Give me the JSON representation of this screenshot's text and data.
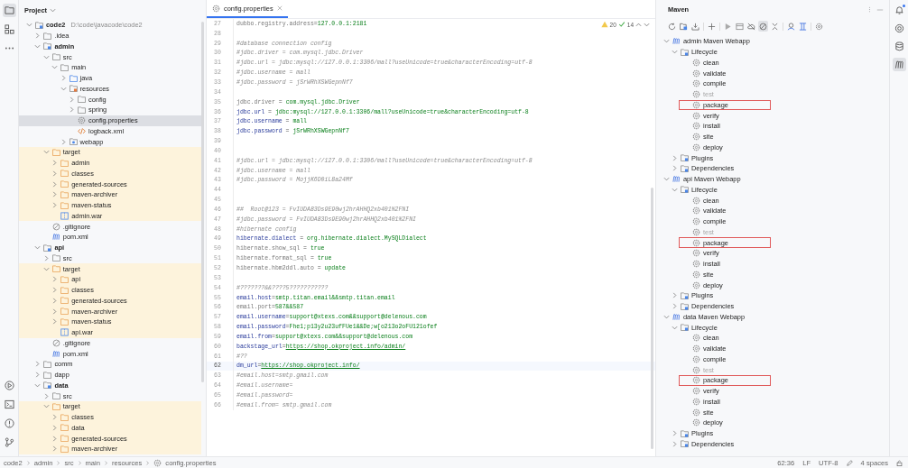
{
  "left_strip": {
    "top": [
      {
        "kind": "project",
        "selected": true
      },
      {
        "kind": "structure",
        "selected": false
      },
      {
        "kind": "more",
        "selected": false
      }
    ],
    "bottom": [
      {
        "kind": "run"
      },
      {
        "kind": "terminal"
      },
      {
        "kind": "problems"
      },
      {
        "kind": "git"
      }
    ]
  },
  "project": {
    "title": "Project",
    "tree": [
      {
        "name": "code2",
        "location": "D:\\code\\javacode\\code2",
        "kind": "module",
        "expanded": true,
        "selected": false,
        "children": [
          {
            "name": ".idea",
            "kind": "folder",
            "expanded": false,
            "selected": false
          },
          {
            "name": "admin",
            "kind": "module",
            "expanded": true,
            "selected": false,
            "children": [
              {
                "name": "src",
                "kind": "folder",
                "expanded": true,
                "selected": false,
                "children": [
                  {
                    "name": "main",
                    "kind": "folder",
                    "expanded": true,
                    "selected": false,
                    "children": [
                      {
                        "name": "java",
                        "kind": "source",
                        "expanded": false,
                        "selected": false
                      },
                      {
                        "name": "resources",
                        "kind": "resources",
                        "expanded": true,
                        "selected": false,
                        "children": [
                          {
                            "name": "config",
                            "kind": "folder",
                            "expanded": false,
                            "selected": false
                          },
                          {
                            "name": "spring",
                            "kind": "folder",
                            "expanded": false,
                            "selected": false
                          },
                          {
                            "name": "config.properties",
                            "kind": "properties",
                            "selected": true
                          },
                          {
                            "name": "logback.xml",
                            "kind": "xml",
                            "selected": false
                          }
                        ]
                      },
                      {
                        "name": "webapp",
                        "kind": "webapp",
                        "expanded": false,
                        "selected": false
                      }
                    ]
                  }
                ]
              },
              {
                "name": "target",
                "kind": "folder",
                "excluded": true,
                "expanded": true,
                "selected": false,
                "children": [
                  {
                    "name": "admin",
                    "kind": "folder",
                    "expanded": false,
                    "selected": false
                  },
                  {
                    "name": "classes",
                    "kind": "folder",
                    "expanded": false,
                    "selected": false
                  },
                  {
                    "name": "generated-sources",
                    "kind": "folder",
                    "expanded": false,
                    "selected": false
                  },
                  {
                    "name": "maven-archiver",
                    "kind": "folder",
                    "expanded": false,
                    "selected": false
                  },
                  {
                    "name": "maven-status",
                    "kind": "folder",
                    "expanded": false,
                    "selected": false
                  },
                  {
                    "name": "admin.war",
                    "kind": "war",
                    "selected": false
                  }
                ]
              },
              {
                "name": ".gitignore",
                "kind": "gitignore",
                "selected": false
              },
              {
                "name": "pom.xml",
                "kind": "pom",
                "selected": false
              }
            ]
          },
          {
            "name": "api",
            "kind": "module",
            "expanded": true,
            "selected": false,
            "children": [
              {
                "name": "src",
                "kind": "folder",
                "expanded": false,
                "selected": false
              },
              {
                "name": "target",
                "kind": "folder",
                "excluded": true,
                "expanded": true,
                "selected": false,
                "children": [
                  {
                    "name": "api",
                    "kind": "folder",
                    "expanded": false,
                    "selected": false
                  },
                  {
                    "name": "classes",
                    "kind": "folder",
                    "expanded": false,
                    "selected": false
                  },
                  {
                    "name": "generated-sources",
                    "kind": "folder",
                    "expanded": false,
                    "selected": false
                  },
                  {
                    "name": "maven-archiver",
                    "kind": "folder",
                    "expanded": false,
                    "selected": false
                  },
                  {
                    "name": "maven-status",
                    "kind": "folder",
                    "expanded": false,
                    "selected": false
                  },
                  {
                    "name": "api.war",
                    "kind": "war",
                    "selected": false
                  }
                ]
              },
              {
                "name": ".gitignore",
                "kind": "gitignore",
                "selected": false
              },
              {
                "name": "pom.xml",
                "kind": "pom",
                "selected": false
              }
            ]
          },
          {
            "name": "comm",
            "kind": "folder",
            "expanded": false,
            "selected": false
          },
          {
            "name": "dapp",
            "kind": "folder",
            "expanded": false,
            "selected": false
          },
          {
            "name": "data",
            "kind": "module",
            "expanded": true,
            "selected": false,
            "children": [
              {
                "name": "src",
                "kind": "folder",
                "expanded": false,
                "selected": false
              },
              {
                "name": "target",
                "kind": "folder",
                "excluded": true,
                "expanded": true,
                "selected": false,
                "children": [
                  {
                    "name": "classes",
                    "kind": "folder",
                    "expanded": false,
                    "selected": false
                  },
                  {
                    "name": "data",
                    "kind": "folder",
                    "expanded": false,
                    "selected": false
                  },
                  {
                    "name": "generated-sources",
                    "kind": "folder",
                    "expanded": false,
                    "selected": false
                  },
                  {
                    "name": "maven-archiver",
                    "kind": "folder",
                    "expanded": false,
                    "selected": false
                  }
                ]
              }
            ]
          }
        ]
      }
    ]
  },
  "editor": {
    "tabs": [
      {
        "label": "config.properties",
        "selected": true
      }
    ],
    "inspections": {
      "warnings": "20",
      "weak_warnings": "14"
    },
    "lines": [
      {
        "number": "27",
        "kind": "property",
        "key": "dubbo.registry.address",
        "sep": "=",
        "value": "127.0.0.1:2181",
        "used": false,
        "current": false
      },
      {
        "number": "28",
        "kind": "blank",
        "current": false
      },
      {
        "number": "29",
        "kind": "comment",
        "text": "#database connection config",
        "current": false
      },
      {
        "number": "30",
        "kind": "comment",
        "text": "#jdbc.driver = com.mysql.jdbc.Driver",
        "current": false
      },
      {
        "number": "31",
        "kind": "comment",
        "text": "#jdbc.url = jdbc:mysql://127.0.0.1:3306/mall?useUnicode=true&characterEncoding=utf-8",
        "current": false
      },
      {
        "number": "32",
        "kind": "comment",
        "text": "#jdbc.username = mall",
        "current": false
      },
      {
        "number": "33",
        "kind": "comment",
        "text": "#jdbc.password = jSrWRhXSWGepnNf7",
        "current": false
      },
      {
        "number": "34",
        "kind": "blank",
        "current": false
      },
      {
        "number": "35",
        "kind": "property",
        "key": "jdbc.driver",
        "sep": " = ",
        "value": "com.mysql.jdbc.Driver",
        "used": false,
        "current": false
      },
      {
        "number": "36",
        "kind": "property",
        "key": "jdbc.url",
        "sep": " = ",
        "value": "jdbc:mysql://127.0.0.1:3306/mall?useUnicode=true&characterEncoding=utf-8",
        "used": true,
        "current": false
      },
      {
        "number": "37",
        "kind": "property",
        "key": "jdbc.username",
        "sep": " = ",
        "value": "mall",
        "used": true,
        "current": false
      },
      {
        "number": "38",
        "kind": "property",
        "key": "jdbc.password",
        "sep": " = ",
        "value": "jSrWRhXSWGepnNf7",
        "used": true,
        "current": false
      },
      {
        "number": "39",
        "kind": "blank",
        "current": false
      },
      {
        "number": "40",
        "kind": "blank",
        "current": false
      },
      {
        "number": "41",
        "kind": "comment",
        "text": "#jdbc.url = jdbc:mysql://127.0.0.1:3306/mall?useUnicode=true&characterEncoding=utf-8",
        "current": false
      },
      {
        "number": "42",
        "kind": "comment",
        "text": "#jdbc.username = mall",
        "current": false
      },
      {
        "number": "43",
        "kind": "comment",
        "text": "#jdbc.password = MojjK6D0iL8a24Mf",
        "current": false
      },
      {
        "number": "44",
        "kind": "blank",
        "current": false
      },
      {
        "number": "45",
        "kind": "blank",
        "current": false
      },
      {
        "number": "46",
        "kind": "comment",
        "text": "##  Root@123 = FvIUDA83Ds9E90wj2hrAHHQ2xb401%2FNI",
        "current": false
      },
      {
        "number": "47",
        "kind": "comment",
        "text": "#jdbc.password = FvIUDA83Ds9E90wj2hrAHHQ2xb401%2FNI",
        "current": false
      },
      {
        "number": "48",
        "kind": "comment",
        "text": "#hibernate config",
        "current": false
      },
      {
        "number": "49",
        "kind": "property",
        "key": "hibernate.dialect",
        "sep": " = ",
        "value": "org.hibernate.dialect.MySQLDialect",
        "used": true,
        "current": false
      },
      {
        "number": "50",
        "kind": "property",
        "key": "hibernate.show_sql",
        "sep": " = ",
        "value": "true",
        "used": false,
        "current": false
      },
      {
        "number": "51",
        "kind": "property",
        "key": "hibernate.format_sql",
        "sep": " = ",
        "value": "true",
        "used": false,
        "current": false
      },
      {
        "number": "52",
        "kind": "property",
        "key": "hibernate.hbm2ddl.auto",
        "sep": " = ",
        "value": "update",
        "used": false,
        "current": false
      },
      {
        "number": "53",
        "kind": "blank",
        "current": false
      },
      {
        "number": "54",
        "kind": "comment",
        "text": "#???????&&????5???????????",
        "current": false
      },
      {
        "number": "55",
        "kind": "property",
        "key": "email.host",
        "sep": "=",
        "value": "smtp.titan.email&&smtp.titan.email",
        "used": true,
        "current": false
      },
      {
        "number": "56",
        "kind": "property",
        "key": "email.port",
        "sep": "=",
        "value": "587&&587",
        "used": false,
        "current": false
      },
      {
        "number": "57",
        "kind": "property",
        "key": "email.username",
        "sep": "=",
        "value": "support@xtexs.com&&support@delenous.com",
        "used": true,
        "current": false
      },
      {
        "number": "58",
        "kind": "property",
        "key": "email.password",
        "sep": "=",
        "value": "Fhe1;p13y2u23ufFUe1&&De;w[o213o2oFU121ofef",
        "used": true,
        "current": false
      },
      {
        "number": "59",
        "kind": "property",
        "key": "email.from",
        "sep": "=",
        "value": "support@xtexs.com&&support@delenous.com",
        "used": true,
        "current": false
      },
      {
        "number": "60",
        "kind": "property",
        "key": "backstage_url",
        "sep": "=",
        "value": "https://shop.okproject.info/admin/",
        "link": true,
        "used": true,
        "current": false
      },
      {
        "number": "61",
        "kind": "comment",
        "text": "#??",
        "current": false
      },
      {
        "number": "62",
        "kind": "property",
        "key": "dm_url",
        "sep": "=",
        "value": "https://shop.okproject.info/",
        "link": true,
        "used": true,
        "current": true
      },
      {
        "number": "63",
        "kind": "comment",
        "text": "#email.host=smtp.gmail.com",
        "current": false
      },
      {
        "number": "64",
        "kind": "comment",
        "text": "#email.username=",
        "current": false
      },
      {
        "number": "65",
        "kind": "comment",
        "text": "#email.password=",
        "current": false
      },
      {
        "number": "66",
        "kind": "comment",
        "text": "#email.from= smtp.gmail.com",
        "current": false
      }
    ]
  },
  "maven": {
    "title": "Maven",
    "toolbar": [
      {
        "kind": "refresh",
        "on": false
      },
      {
        "kind": "add-folder",
        "on": false
      },
      {
        "kind": "download",
        "on": false
      },
      {
        "kind": "plus",
        "on": false
      },
      {
        "kind": "run",
        "on": false
      },
      {
        "kind": "panel",
        "on": false
      },
      {
        "kind": "offline",
        "on": false
      },
      {
        "kind": "skip",
        "on": true
      },
      {
        "kind": "collapse",
        "on": false
      },
      {
        "kind": "person",
        "on": false
      },
      {
        "kind": "columns",
        "on": false
      },
      {
        "kind": "settings",
        "on": false
      }
    ],
    "projects": [
      {
        "name": "admin Maven Webapp",
        "expanded": true,
        "sections": [
          {
            "name": "Lifecycle",
            "expanded": true,
            "goals": [
              {
                "name": "clean",
                "disabled": false,
                "highlighted": false
              },
              {
                "name": "validate",
                "disabled": false,
                "highlighted": false
              },
              {
                "name": "compile",
                "disabled": false,
                "highlighted": false
              },
              {
                "name": "test",
                "disabled": true,
                "highlighted": false
              },
              {
                "name": "package",
                "disabled": false,
                "highlighted": true
              },
              {
                "name": "verify",
                "disabled": false,
                "highlighted": false
              },
              {
                "name": "install",
                "disabled": false,
                "highlighted": false
              },
              {
                "name": "site",
                "disabled": false,
                "highlighted": false
              },
              {
                "name": "deploy",
                "disabled": false,
                "highlighted": false
              }
            ]
          },
          {
            "name": "Plugins",
            "expanded": false
          },
          {
            "name": "Dependencies",
            "expanded": false
          }
        ]
      },
      {
        "name": "api Maven Webapp",
        "expanded": true,
        "sections": [
          {
            "name": "Lifecycle",
            "expanded": true,
            "goals": [
              {
                "name": "clean",
                "disabled": false,
                "highlighted": false
              },
              {
                "name": "validate",
                "disabled": false,
                "highlighted": false
              },
              {
                "name": "compile",
                "disabled": false,
                "highlighted": false
              },
              {
                "name": "test",
                "disabled": true,
                "highlighted": false
              },
              {
                "name": "package",
                "disabled": false,
                "highlighted": true
              },
              {
                "name": "verify",
                "disabled": false,
                "highlighted": false
              },
              {
                "name": "install",
                "disabled": false,
                "highlighted": false
              },
              {
                "name": "site",
                "disabled": false,
                "highlighted": false
              },
              {
                "name": "deploy",
                "disabled": false,
                "highlighted": false
              }
            ]
          },
          {
            "name": "Plugins",
            "expanded": false
          },
          {
            "name": "Dependencies",
            "expanded": false
          }
        ]
      },
      {
        "name": "data Maven Webapp",
        "expanded": true,
        "sections": [
          {
            "name": "Lifecycle",
            "expanded": true,
            "goals": [
              {
                "name": "clean",
                "disabled": false,
                "highlighted": false
              },
              {
                "name": "validate",
                "disabled": false,
                "highlighted": false
              },
              {
                "name": "compile",
                "disabled": false,
                "highlighted": false
              },
              {
                "name": "test",
                "disabled": true,
                "highlighted": false
              },
              {
                "name": "package",
                "disabled": false,
                "highlighted": true
              },
              {
                "name": "verify",
                "disabled": false,
                "highlighted": false
              },
              {
                "name": "install",
                "disabled": false,
                "highlighted": false
              },
              {
                "name": "site",
                "disabled": false,
                "highlighted": false
              },
              {
                "name": "deploy",
                "disabled": false,
                "highlighted": false
              }
            ]
          },
          {
            "name": "Plugins",
            "expanded": false
          },
          {
            "name": "Dependencies",
            "expanded": false
          }
        ]
      }
    ]
  },
  "right_strip": [
    {
      "kind": "notifications",
      "badge": true,
      "selected": false
    },
    {
      "kind": "ai",
      "selected": false
    },
    {
      "kind": "database",
      "selected": false
    },
    {
      "kind": "maven",
      "selected": true
    }
  ],
  "status_bar": {
    "breadcrumbs": [
      "code2",
      "admin",
      "src",
      "main",
      "resources",
      "config.properties"
    ],
    "position": "62:36",
    "line_separator": "LF",
    "encoding": "UTF-8",
    "indent": "4 spaces"
  }
}
